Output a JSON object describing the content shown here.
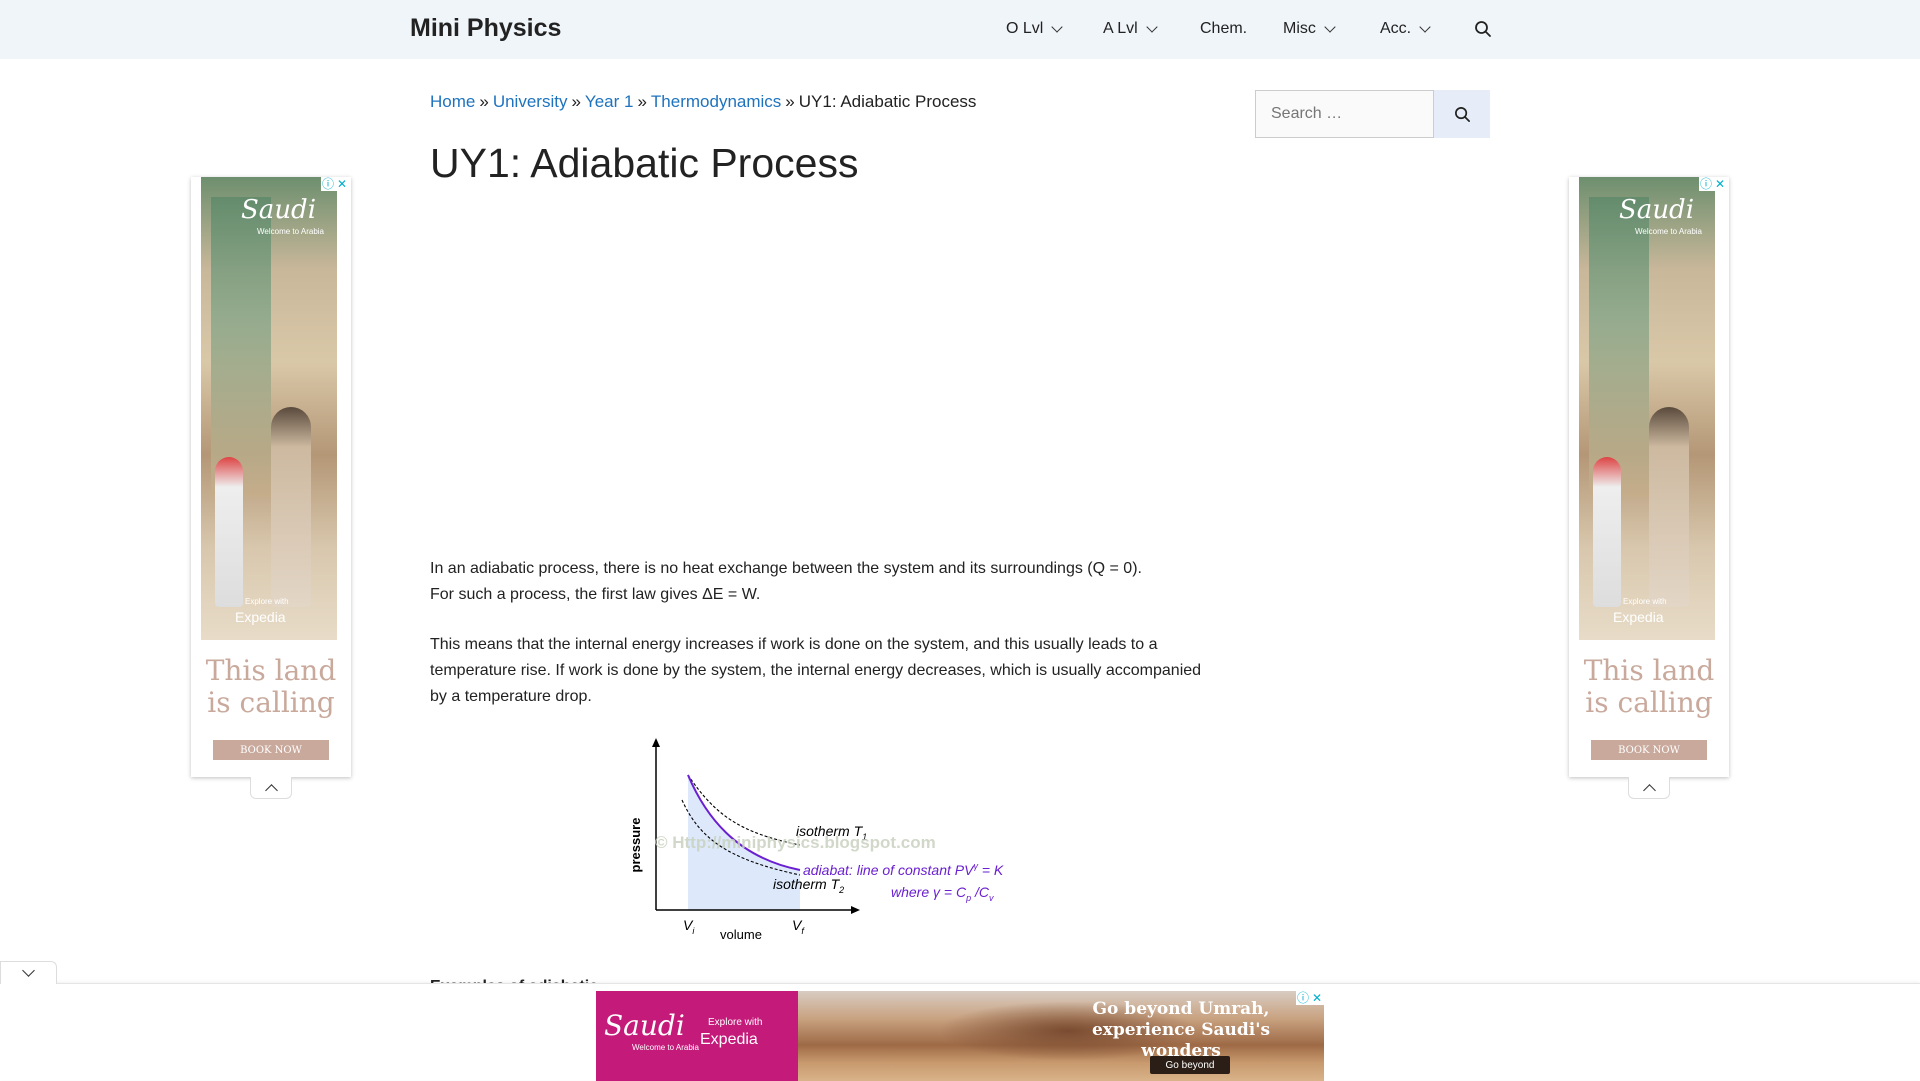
{
  "header": {
    "site_title": "Mini Physics",
    "nav": [
      {
        "label": "O Lvl",
        "has_dropdown": true
      },
      {
        "label": "A Lvl",
        "has_dropdown": true
      },
      {
        "label": "Chem.",
        "has_dropdown": false
      },
      {
        "label": "Misc",
        "has_dropdown": true
      },
      {
        "label": "Acc.",
        "has_dropdown": true
      }
    ],
    "search_icon": "search-icon"
  },
  "breadcrumb": {
    "items": [
      "Home",
      "University",
      "Year 1",
      "Thermodynamics"
    ],
    "current": "UY1: Adiabatic Process",
    "separator": "»"
  },
  "article": {
    "title": "UY1: Adiabatic Process",
    "paragraph1_line1": "In an adiabatic process, there is no heat exchange between the system and its surroundings (Q = 0).",
    "paragraph1_line2": "For such a process, the first law gives ΔE = W.",
    "paragraph2": "This means that the internal energy increases if work is done on the system, and this usually leads to a temperature rise. If work is done by the system, the internal energy decreases, which is usually accompanied by a temperature drop.",
    "next_heading_partial": "Examples of adiabatic..."
  },
  "diagram": {
    "y_axis_label": "pressure",
    "x_axis_label": "volume",
    "vi_label": "V",
    "vi_sub": "i",
    "vf_label": "V",
    "vf_sub": "f",
    "isotherm1": "isotherm T",
    "isotherm1_sub": "1",
    "isotherm2": "isotherm T",
    "isotherm2_sub": "2",
    "adiabat_label": "adiabat: line of constant PV",
    "adiabat_sup": "γ",
    "adiabat_rhs": " = K",
    "gamma_def": "where γ = C",
    "gamma_p": "p",
    "gamma_v": "v",
    "watermark": "© Http://miniphysics.blogspot.com",
    "adiabat_color": "#6a1fd1"
  },
  "sidebar": {
    "search_placeholder": "Search …"
  },
  "side_ads": {
    "brand": "Saudi",
    "brand_sub": "Welcome to Arabia",
    "explore": "Explore with",
    "expedia": "Expedia",
    "tagline": "This land is calling",
    "cta": "BOOK NOW"
  },
  "bottom_ad": {
    "brand": "Saudi",
    "brand_sub": "Welcome to Arabia",
    "explore": "Explore with",
    "expedia": "Expedia",
    "headline": "Go beyond Umrah, experience Saudi's wonders",
    "cta": "Go beyond"
  },
  "colors": {
    "link": "#1e73be",
    "header_bg": "#f0f5fa",
    "ad_magenta": "#c41a7a",
    "ad_choices": "#00aecd"
  }
}
